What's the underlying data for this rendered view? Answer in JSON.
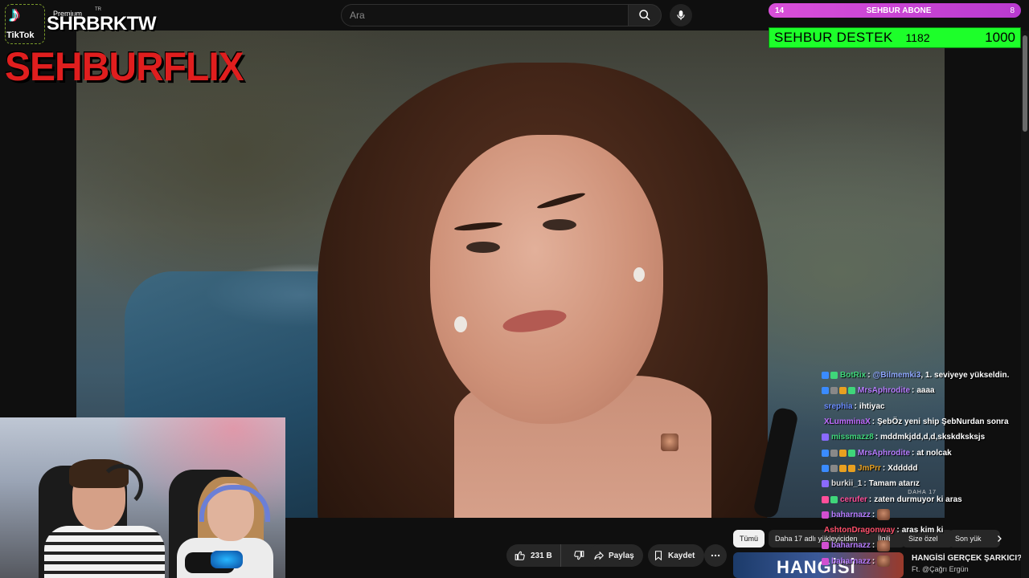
{
  "youtube": {
    "search_placeholder": "Ara",
    "actions": {
      "like_count": "231 B",
      "share_label": "Paylaş",
      "save_label": "Kaydet"
    },
    "chips": [
      "Tümü",
      "Daha 17 adlı yükleyiciden",
      "İlgili",
      "Size özel",
      "Son yük"
    ],
    "recommended": {
      "thumb_text": "HANGİSİ",
      "title": "HANGİSİ GERÇEK ŞARKICI?",
      "subtitle": "Ft. @Çağrı Ergün"
    },
    "video_watermark": "DAHA 17"
  },
  "stream_overlay": {
    "tiktok_label": "TikTok",
    "premium_label": "Premium",
    "premium_region": "TR",
    "handle": "SHRBRKTW",
    "brand": "SEHBURFLIX",
    "abone_bar": {
      "left_value": "14",
      "title": "SEHBUR ABONE",
      "right_value": "8"
    },
    "destek_bar": {
      "title": "SEHBUR DESTEK",
      "current": "1182",
      "goal": "1000"
    }
  },
  "chat": {
    "messages": [
      {
        "user": "BotRix",
        "user_color": "#3fd67a",
        "text": "@Bilmemki3, 1. seviyeye yükseldin.",
        "mention": "@Bilmemki3",
        "badges": [
          "#3a8bff",
          "#3fd67a"
        ]
      },
      {
        "user": "MrsAphrodite",
        "user_color": "#b77cff",
        "text": "aaaa",
        "badges": [
          "#3a8bff",
          "#888",
          "#e8a020",
          "#3fd67a"
        ]
      },
      {
        "user": "srephia",
        "user_color": "#6a8cff",
        "text": "ihtiyac",
        "badges": []
      },
      {
        "user": "XLumminaX",
        "user_color": "#c06bff",
        "text": "ŞebÖz yeni ship ŞebNurdan sonra",
        "badges": []
      },
      {
        "user": "missmazz8",
        "user_color": "#3fd67a",
        "text": "mddmkjdd,d,d,skskdksksjs",
        "badges": [
          "#8a6aff"
        ]
      },
      {
        "user": "MrsAphrodite",
        "user_color": "#b77cff",
        "text": "at nolcak",
        "badges": [
          "#3a8bff",
          "#888",
          "#e8a020",
          "#3fd67a"
        ]
      },
      {
        "user": "JmPrr",
        "user_color": "#e8a020",
        "text": "Xddddd",
        "badges": [
          "#3a8bff",
          "#888",
          "#e8a020",
          "#e8a020"
        ]
      },
      {
        "user": "burkii_1",
        "user_color": "#e0e0e0",
        "text": "Tamam atarız",
        "badges": [
          "#8a6aff"
        ]
      },
      {
        "user": "cerufer",
        "user_color": "#ff4f9a",
        "text": "zaten durmuyor ki aras",
        "badges": [
          "#ff4f9a",
          "#3fd67a"
        ]
      },
      {
        "user": "baharnazz",
        "user_color": "#b77cff",
        "text": "",
        "emote": true,
        "badges": [
          "#d14fd1"
        ]
      },
      {
        "user": "AshtonDragonway",
        "user_color": "#ff4f6a",
        "text": "aras kim ki",
        "badges": []
      },
      {
        "user": "baharnazz",
        "user_color": "#b77cff",
        "text": "",
        "emote": true,
        "badges": [
          "#d14fd1"
        ]
      },
      {
        "user": "baharnazz",
        "user_color": "#b77cff",
        "text": "",
        "emote": true,
        "badges": [
          "#d14fd1"
        ]
      }
    ]
  },
  "colors": {
    "brand_red": "#e01e1e",
    "abone_purple": "#c94ad6",
    "destek_green": "#1dff2a"
  },
  "icons": [
    "search-icon",
    "mic-icon",
    "like-icon",
    "dislike-icon",
    "share-icon",
    "save-icon",
    "more-icon",
    "chevron-right-icon",
    "tiktok-icon"
  ]
}
